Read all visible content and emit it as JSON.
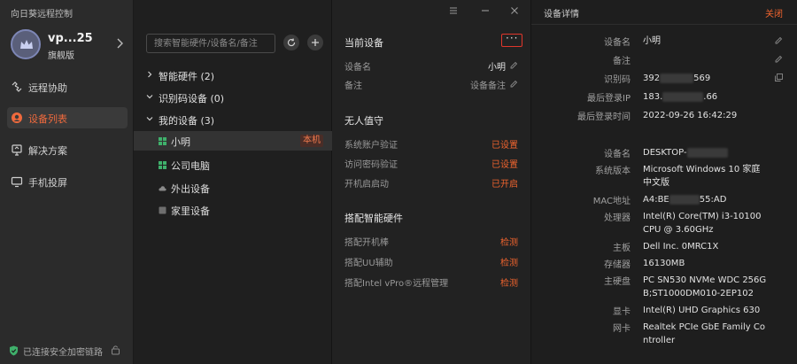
{
  "app": {
    "title": "向日葵远程控制"
  },
  "profile": {
    "name": "vp...25",
    "edition": "旗舰版"
  },
  "sidebar": {
    "items": [
      {
        "label": "远程协助",
        "icon": "remote-assist-icon",
        "active": false
      },
      {
        "label": "设备列表",
        "icon": "device-list-icon",
        "active": true
      },
      {
        "label": "解决方案",
        "icon": "solution-icon",
        "active": false
      },
      {
        "label": "手机投屏",
        "icon": "screen-cast-icon",
        "active": false
      }
    ],
    "secure_text": "已连接安全加密链路"
  },
  "devices": {
    "search_placeholder": "搜索智能硬件/设备名/备注",
    "groups": [
      {
        "label": "智能硬件 (2)",
        "expanded": false
      },
      {
        "label": "识别码设备 (0)",
        "expanded": true
      },
      {
        "label": "我的设备 (3)",
        "expanded": true
      }
    ],
    "items": [
      {
        "label": "小明",
        "badge": "本机",
        "status": "online"
      },
      {
        "label": "公司电脑",
        "badge": "",
        "status": "online"
      },
      {
        "label": "外出设备",
        "badge": "",
        "status": "cloud"
      },
      {
        "label": "家里设备",
        "badge": "",
        "status": "offline"
      }
    ]
  },
  "current": {
    "title": "当前设备",
    "more_label": "···",
    "fields": [
      {
        "key": "设备名",
        "value": "小明"
      },
      {
        "key": "备注",
        "value": "设备备注"
      }
    ],
    "unattended_title": "无人值守",
    "unattended": [
      {
        "key": "系统账户验证",
        "value": "已设置"
      },
      {
        "key": "访问密码验证",
        "value": "已设置"
      },
      {
        "key": "开机启启动",
        "value": "已开启"
      }
    ],
    "hardware_title": "搭配智能硬件",
    "hardware": [
      {
        "key": "搭配开机棒",
        "value": "检测"
      },
      {
        "key": "搭配UU辅助",
        "value": "检测"
      },
      {
        "key": "搭配Intel vPro®远程管理",
        "value": "检测"
      }
    ]
  },
  "details": {
    "title": "设备详情",
    "close_label": "关闭",
    "rows": [
      {
        "key": "设备名",
        "value": "小明"
      },
      {
        "key": "备注",
        "value": ""
      },
      {
        "key": "识别码",
        "prefix": "392",
        "suffix": "569"
      },
      {
        "key": "最后登录IP",
        "prefix": "183.",
        "suffix": ".66"
      },
      {
        "key": "最后登录时间",
        "value": "2022-09-26 16:42:29"
      },
      {
        "key": "设备名",
        "prefix": "DESKTOP-",
        "suffix": ""
      },
      {
        "key": "系统版本",
        "value": "Microsoft Windows 10 家庭中文版"
      },
      {
        "key": "MAC地址",
        "prefix": "A4:BE",
        "suffix": "55:AD"
      },
      {
        "key": "处理器",
        "value": "Intel(R) Core(TM) i3-10100 CPU @ 3.60GHz"
      },
      {
        "key": "主板",
        "value": "Dell Inc. 0MRC1X"
      },
      {
        "key": "存储器",
        "value": "16130MB"
      },
      {
        "key": "主硬盘",
        "value": "PC SN530 NVMe WDC 256GB;ST1000DM010-2EP102"
      },
      {
        "key": "显卡",
        "value": "Intel(R) UHD Graphics 630"
      },
      {
        "key": "网卡",
        "value": "Realtek PCIe GbE Family Controller"
      }
    ]
  },
  "colors": {
    "accent": "#f0642e",
    "sidebar_bg": "#2b2b2b",
    "panel_bg": "#1f1f1f"
  }
}
